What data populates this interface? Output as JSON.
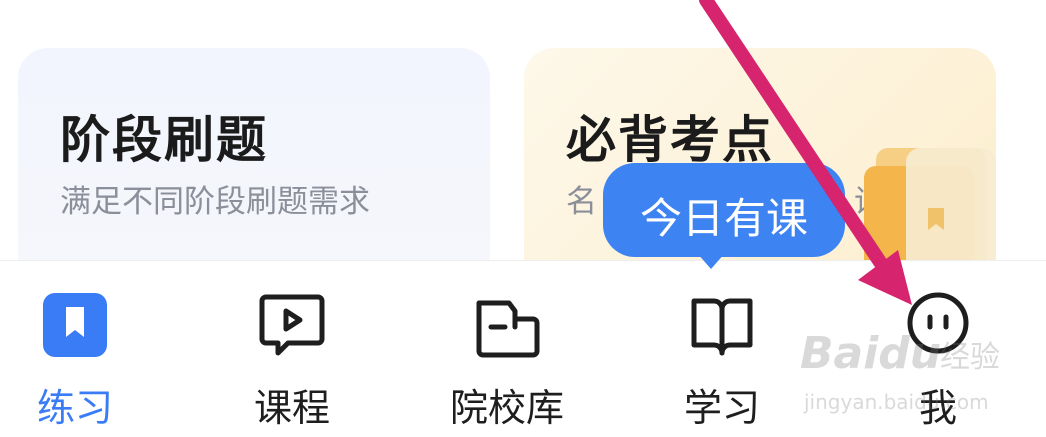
{
  "cards": [
    {
      "title": "阶段刷题",
      "subtitle": "满足不同阶段刷题需求"
    },
    {
      "title": "必背考点",
      "subtitle_visible_start": "名",
      "subtitle_visible_end": "诵"
    }
  ],
  "tooltip": {
    "text": "今日有课"
  },
  "tabs": [
    {
      "label": "练习",
      "icon": "bookmark-icon",
      "active": true
    },
    {
      "label": "课程",
      "icon": "video-play-icon",
      "active": false
    },
    {
      "label": "院校库",
      "icon": "school-folder-icon",
      "active": false
    },
    {
      "label": "学习",
      "icon": "open-book-icon",
      "active": false
    },
    {
      "label": "我",
      "icon": "face-icon",
      "active": false
    }
  ],
  "watermark": {
    "brand": "Baidu",
    "cn": "经验",
    "url": "jingyan.baidu.com"
  },
  "colors": {
    "accent": "#3a7cf5",
    "tooltip": "#3d83f2",
    "arrow": "#d6246e"
  }
}
